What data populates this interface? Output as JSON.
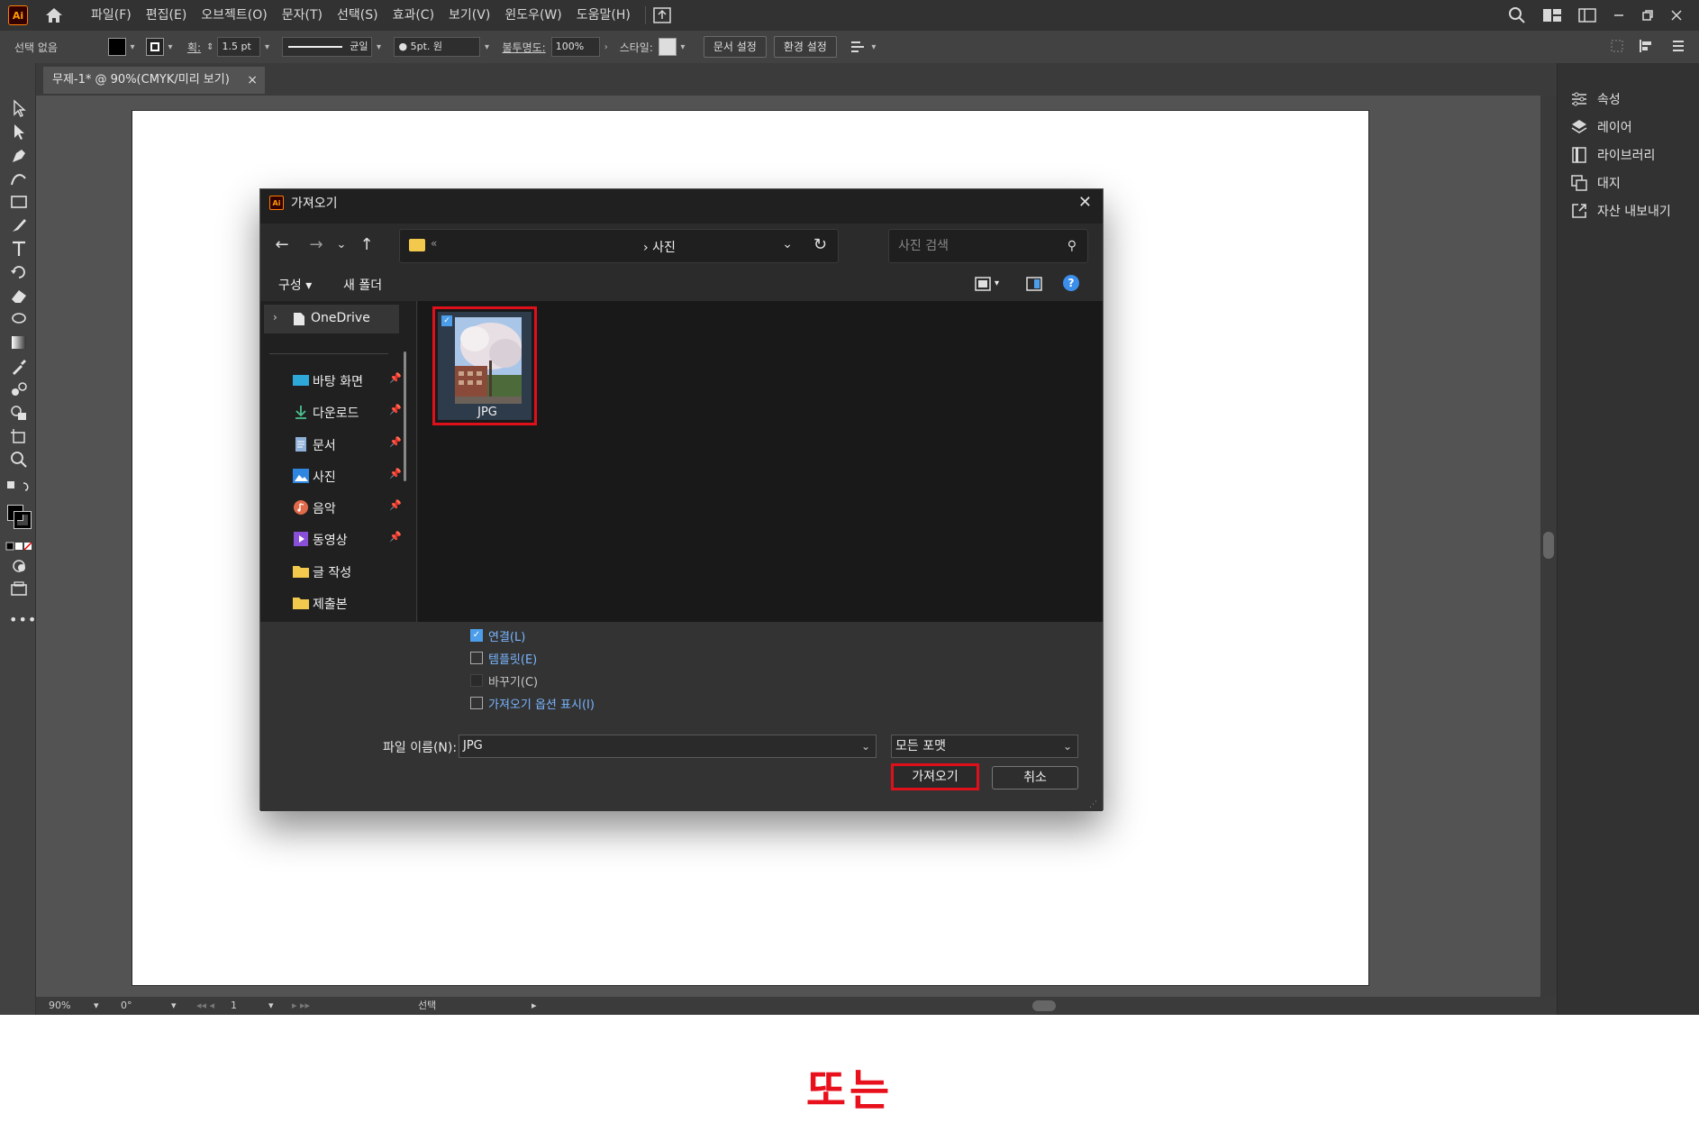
{
  "app": {
    "logo": "Ai",
    "menus": [
      "파일(F)",
      "편집(E)",
      "오브젝트(O)",
      "문자(T)",
      "선택(S)",
      "효과(C)",
      "보기(V)",
      "윈도우(W)",
      "도움말(H)"
    ]
  },
  "control_bar": {
    "selection": "선택 없음",
    "stroke_label": "획:",
    "stroke_value": "1.5 pt",
    "profile_label": "균일",
    "brush_value": "5pt. 원",
    "opacity_label": "불투명도:",
    "opacity_value": "100%",
    "style_label": "스타일:",
    "doc_setup": "문서 설정",
    "preferences": "환경 설정"
  },
  "document": {
    "tab_title": "무제-1* @ 90%(CMYK/미리 보기)"
  },
  "status_bar": {
    "zoom": "90%",
    "rotation": "0°",
    "artboard": "1",
    "tool": "선택"
  },
  "right_panel": {
    "items": [
      "속성",
      "레이어",
      "라이브러리",
      "대지",
      "자산 내보내기"
    ]
  },
  "dialog": {
    "title": "가져오기",
    "breadcrumb_dots": "«",
    "breadcrumb": "사진",
    "search_placeholder": "사진 검색",
    "organize": "구성",
    "new_folder": "새 폴더",
    "help": "?",
    "onedrive": "OneDrive",
    "sidebar": [
      {
        "label": "바탕 화면",
        "icon": "desktop-icon",
        "pinned": true
      },
      {
        "label": "다운로드",
        "icon": "download-icon",
        "pinned": true
      },
      {
        "label": "문서",
        "icon": "document-icon",
        "pinned": true
      },
      {
        "label": "사진",
        "icon": "pictures-icon",
        "pinned": true
      },
      {
        "label": "음악",
        "icon": "music-icon",
        "pinned": true
      },
      {
        "label": "동영상",
        "icon": "video-icon",
        "pinned": true
      },
      {
        "label": "글 작성",
        "icon": "folder-icon",
        "pinned": false
      },
      {
        "label": "제출본",
        "icon": "folder-icon",
        "pinned": false
      }
    ],
    "file": {
      "name": "JPG",
      "selected": true
    },
    "options": [
      {
        "label": "연결(L)",
        "checked": true,
        "enabled": true
      },
      {
        "label": "템플릿(E)",
        "checked": false,
        "enabled": true
      },
      {
        "label": "바꾸기(C)",
        "checked": false,
        "enabled": false
      },
      {
        "label": "가져오기 옵션 표시(I)",
        "checked": false,
        "enabled": true
      }
    ],
    "filename_label": "파일 이름(N):",
    "filename_value": "JPG",
    "format_value": "모든 포맷",
    "import_button": "가져오기",
    "cancel_button": "취소"
  },
  "caption": "또는",
  "colors": {
    "highlight": "#e0101b",
    "caption": "#e8101c",
    "accent_blue": "#4c9eea"
  }
}
